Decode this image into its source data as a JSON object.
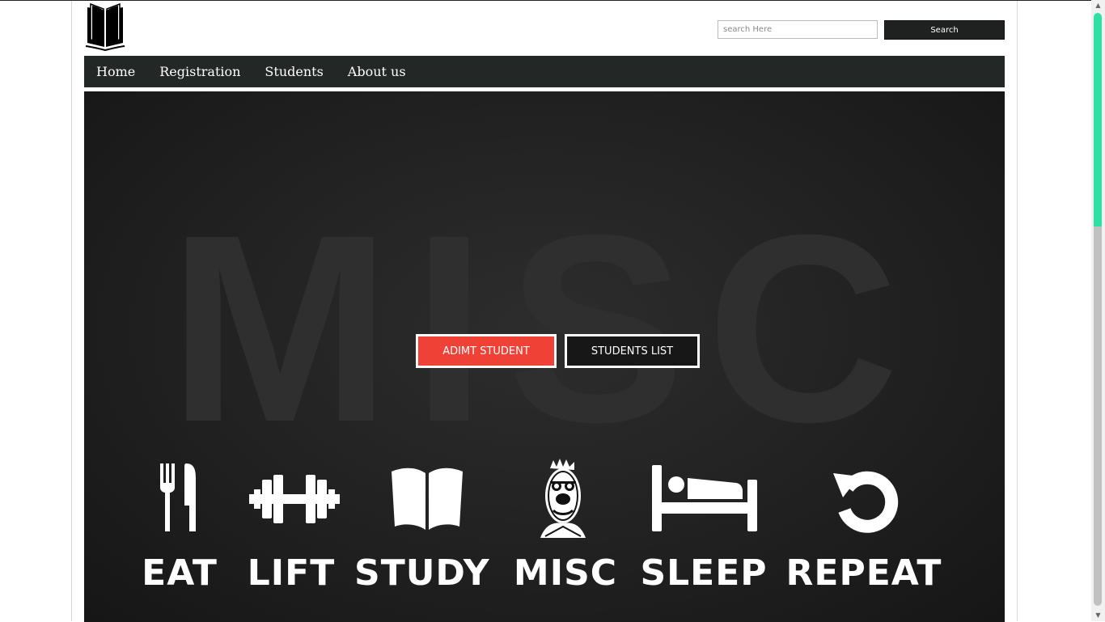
{
  "header": {
    "search_placeholder": "search Here",
    "search_value": "",
    "search_button": "Search"
  },
  "nav": {
    "items": [
      "Home",
      "Registration",
      "Students",
      "About us"
    ]
  },
  "hero": {
    "background_word": "MISC",
    "admit_button": "ADIMT STUDENT",
    "list_button": "STUDENTS LIST",
    "accent_color": "#ef4136",
    "activities": [
      {
        "label": "EAT",
        "icon": "fork-knife-icon"
      },
      {
        "label": "LIFT",
        "icon": "barbell-icon"
      },
      {
        "label": "STUDY",
        "icon": "open-book-icon"
      },
      {
        "label": "MISC",
        "icon": "muppet-face-icon"
      },
      {
        "label": "SLEEP",
        "icon": "bed-icon"
      },
      {
        "label": "REPEAT",
        "icon": "repeat-arrow-icon"
      }
    ]
  },
  "colors": {
    "nav_bg": "#232826",
    "scroll_thumb_accent": "#2fe0a6"
  }
}
